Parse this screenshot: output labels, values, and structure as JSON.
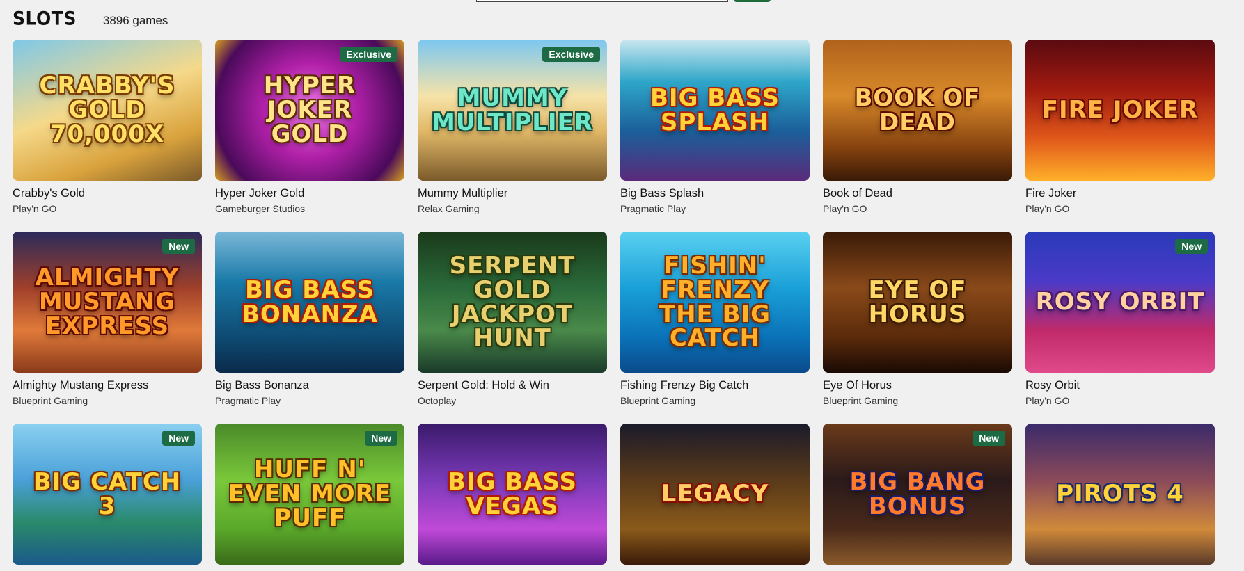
{
  "header": {
    "title": "SLOTS",
    "count": "3896 games"
  },
  "games": [
    {
      "name": "Crabby's Gold",
      "provider": "Play'n GO",
      "badge": "",
      "art": "CRABBY'S GOLD 70,000x",
      "bg": "linear-gradient(160deg,#7ec8e8 0%,#f5d98a 45%,#d9a23c 75%,#7a5a2a 100%)",
      "fg": "#ffe066",
      "stroke": "#7a3b00"
    },
    {
      "name": "Hyper Joker Gold",
      "provider": "Gameburger Studios",
      "badge": "Exclusive",
      "art": "HYPER JOKER GOLD",
      "bg": "radial-gradient(circle at 50% 50%,#f07ae8 0%,#b020a8 40%,#4a0a5a 80%,#d8a020 100%)",
      "fg": "#ffe38a",
      "stroke": "#5a2a00"
    },
    {
      "name": "Mummy Multiplier",
      "provider": "Relax Gaming",
      "badge": "Exclusive",
      "art": "MUMMY MULTIPLIER",
      "bg": "linear-gradient(180deg,#7cc7f0 0%,#f6e3a8 40%,#e1b867 65%,#7a5a2a 100%)",
      "fg": "#6ee6c8",
      "stroke": "#114a3a"
    },
    {
      "name": "Big Bass Splash",
      "provider": "Pragmatic Play",
      "badge": "",
      "art": "BIG BASS SPLASH",
      "bg": "linear-gradient(180deg,#c9e7ef 0%,#2ea6c9 30%,#1b5f9a 65%,#5a2a7a 100%)",
      "fg": "#ffd23a",
      "stroke": "#b01a00"
    },
    {
      "name": "Book of Dead",
      "provider": "Play'n GO",
      "badge": "",
      "art": "BOOK OF DEAD",
      "bg": "linear-gradient(180deg,#b0621c 0%,#d98a2a 40%,#8a4510 75%,#3a1a06 100%)",
      "fg": "#ffcf66",
      "stroke": "#5a0a00"
    },
    {
      "name": "Fire Joker",
      "provider": "Play'n GO",
      "badge": "",
      "art": "FIRE JOKER",
      "bg": "linear-gradient(180deg,#5a0a10 0%,#a01a10 35%,#e0581a 70%,#ffb02a 100%)",
      "fg": "#ffb347",
      "stroke": "#6a0a00"
    },
    {
      "name": "Almighty Mustang Express",
      "provider": "Blueprint Gaming",
      "badge": "New",
      "art": "ALMIGHTY MUSTANG EXPRESS",
      "bg": "linear-gradient(180deg,#2a2a5a 0%,#a0402a 40%,#e07a3a 70%,#8a3a1a 100%)",
      "fg": "#ff9a2a",
      "stroke": "#5a0a00"
    },
    {
      "name": "Big Bass Bonanza",
      "provider": "Pragmatic Play",
      "badge": "",
      "art": "BIG BASS BONANZA",
      "bg": "linear-gradient(180deg,#7ab8d8 0%,#1a7aa8 35%,#0e4a72 75%,#0a2a4a 100%)",
      "fg": "#ffd23a",
      "stroke": "#b01a00"
    },
    {
      "name": "Serpent Gold: Hold & Win",
      "provider": "Octoplay",
      "badge": "",
      "art": "SERPENT GOLD JACKPOT HUNT",
      "bg": "linear-gradient(180deg,#1a3a1a 0%,#2a6a3a 40%,#4a8a4a 70%,#1a3a2a 100%)",
      "fg": "#e8d070",
      "stroke": "#2a3a0a"
    },
    {
      "name": "Fishing Frenzy Big Catch",
      "provider": "Blueprint Gaming",
      "badge": "",
      "art": "FISHIN' FRENZY THE BIG CATCH",
      "bg": "linear-gradient(180deg,#5ad0f0 0%,#1aa0d8 40%,#0a72b8 75%,#0a4a8a 100%)",
      "fg": "#ffb02a",
      "stroke": "#7a2a00"
    },
    {
      "name": "Eye Of Horus",
      "provider": "Blueprint Gaming",
      "badge": "",
      "art": "EYE OF HORUS",
      "bg": "linear-gradient(180deg,#3a1a08 0%,#8a4a1a 40%,#5a2a0a 75%,#1a0a04 100%)",
      "fg": "#ffd766",
      "stroke": "#3a1a00"
    },
    {
      "name": "Rosy Orbit",
      "provider": "Play'n GO",
      "badge": "New",
      "art": "ROSY ORBIT",
      "bg": "linear-gradient(180deg,#2a3ab8 0%,#4a3ac8 35%,#c02a6a 70%,#e04a8a 100%)",
      "fg": "#ffd0a0",
      "stroke": "#4a1a6a"
    },
    {
      "name": "",
      "provider": "",
      "badge": "New",
      "art": "BIG CATCH 3",
      "bg": "linear-gradient(180deg,#8ad0f0 0%,#4aa0d8 40%,#2a8a6a 70%,#1a5a8a 100%)",
      "fg": "#ffd23a",
      "stroke": "#7a2a00"
    },
    {
      "name": "",
      "provider": "",
      "badge": "New",
      "art": "HUFF N' EVEN MORE PUFF",
      "bg": "linear-gradient(180deg,#4a8a2a 0%,#7ac83a 40%,#5aa82a 75%,#3a6a1a 100%)",
      "fg": "#ffc02a",
      "stroke": "#5a2a00"
    },
    {
      "name": "",
      "provider": "",
      "badge": "",
      "art": "BIG BASS VEGAS",
      "bg": "linear-gradient(180deg,#3a1a6a 0%,#7a3ab8 40%,#c04ad8 75%,#5a1a8a 100%)",
      "fg": "#ffd23a",
      "stroke": "#b01a00"
    },
    {
      "name": "",
      "provider": "",
      "badge": "",
      "art": "LEGACY",
      "bg": "linear-gradient(180deg,#1a1a2a 0%,#5a3a1a 40%,#8a5a1a 75%,#3a1a0a 100%)",
      "fg": "#ffcf66",
      "stroke": "#8a0a00"
    },
    {
      "name": "",
      "provider": "",
      "badge": "New",
      "art": "BIG BANG BONUS",
      "bg": "linear-gradient(180deg,#6a3a1a 0%,#2a1a1a 40%,#4a2a1a 75%,#8a5a2a 100%)",
      "fg": "#ff7a2a",
      "stroke": "#1a1a6a"
    },
    {
      "name": "",
      "provider": "",
      "badge": "",
      "art": "PIROTS 4",
      "bg": "linear-gradient(180deg,#3a2a6a 0%,#8a4a5a 40%,#d08a3a 75%,#5a3a2a 100%)",
      "fg": "#ffd23a",
      "stroke": "#1a2a6a"
    }
  ]
}
